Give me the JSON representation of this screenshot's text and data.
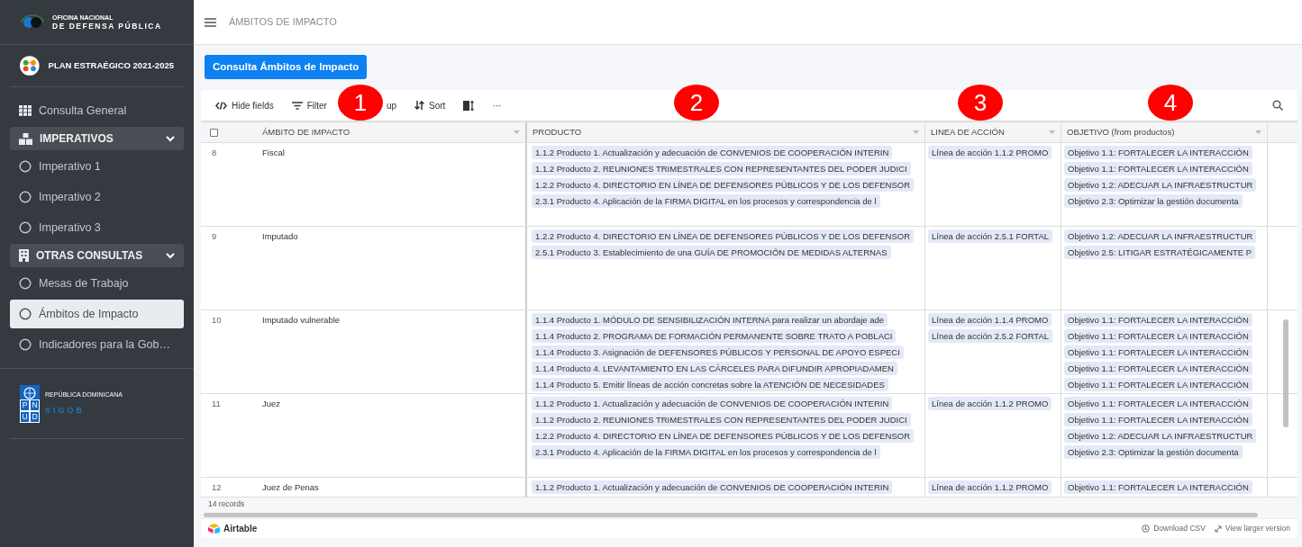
{
  "sidebar": {
    "org_logo": {
      "line1": "OFICINA NACIONAL",
      "line2": "DE DEFENSA PÚBLICA"
    },
    "plan_title": "PLAN ESTRAÉGICO 2021-2025",
    "nav": [
      {
        "kind": "link",
        "label": "Consulta General",
        "selected": false
      },
      {
        "kind": "group",
        "label": "IMPERATIVOS",
        "expanded": true,
        "selected": false
      },
      {
        "kind": "item",
        "label": "Imperativo 1",
        "selected": false
      },
      {
        "kind": "item",
        "label": "Imperativo 2",
        "selected": false
      },
      {
        "kind": "item",
        "label": "Imperativo 3",
        "selected": false
      },
      {
        "kind": "group",
        "label": "OTRAS CONSULTAS",
        "expanded": true,
        "selected": false
      },
      {
        "kind": "item",
        "label": "Mesas de Trabajo",
        "selected": false
      },
      {
        "kind": "item",
        "label": "Ámbitos de Impacto",
        "selected": true
      },
      {
        "kind": "item",
        "label": "Indicadores para la Gob…",
        "selected": false
      }
    ],
    "footer": {
      "pnud_letters": [
        "P",
        "N",
        "U",
        "D"
      ],
      "country": "REPÚBLICA DOMINICANA",
      "brand": "SIGOB"
    }
  },
  "header": {
    "title": "ÁMBITOS DE IMPACTO"
  },
  "action_button": "Consulta Ámbitos de Impacto",
  "toolbar": [
    {
      "kind": "hide",
      "label": "Hide fields"
    },
    {
      "kind": "filter",
      "label": "Filter"
    },
    {
      "kind": "group",
      "label": "up"
    },
    {
      "kind": "sort",
      "label": "Sort"
    },
    {
      "kind": "height"
    },
    {
      "kind": "more",
      "label": "···"
    }
  ],
  "annotations": [
    "1",
    "2",
    "3",
    "4"
  ],
  "table": {
    "select_all_checked": false,
    "columns": [
      "ÁMBITO DE IMPACTO",
      "PRODUCTO",
      "LINEA DE ACCIÓN",
      "OBJETIVO (from productos)"
    ],
    "rows": [
      {
        "number": "8",
        "ambito": "Fiscal",
        "productos": [
          "1.1.2 Producto 1. Actualización y adecuación de CONVENIOS DE COOPERACIÓN INTERIN",
          "1.1.2 Producto 2. REUNIONES TRIMESTRALES CON REPRESENTANTES DEL PODER JUDICI",
          "1.2.2 Producto 4. DIRECTORIO EN LÍNEA DE DEFENSORES PÚBLICOS Y DE LOS DEFENSOR",
          "2.3.1 Producto 4. Aplicación de la FIRMA DIGITAL en los procesos y correspondencia de l"
        ],
        "lineas": [
          "Línea de acción 1.1.2 PROMO"
        ],
        "objetivos": [
          "Objetivo 1.1: FORTALECER LA INTERACCIÓN",
          "Objetivo 1.1: FORTALECER LA INTERACCIÓN",
          "Objetivo 1.2: ADECUAR LA INFRAESTRUCTUR",
          "Objetivo 2.3: Optimizar la gestión documenta"
        ]
      },
      {
        "number": "9",
        "ambito": "Imputado",
        "productos": [
          "1.2.2 Producto 4. DIRECTORIO EN LÍNEA DE DEFENSORES PÚBLICOS Y DE LOS DEFENSOR",
          "2.5.1 Producto 3. Establecimiento de una GUÍA DE PROMOCIÓN DE MEDIDAS ALTERNAS"
        ],
        "lineas": [
          "Línea de acción 2.5.1 FORTAL"
        ],
        "objetivos": [
          "Objetivo 1.2: ADECUAR LA INFRAESTRUCTUR",
          "Objetivo 2.5: LITIGAR ESTRATÉGICAMENTE P"
        ]
      },
      {
        "number": "10",
        "ambito": "Imputado vulnerable",
        "productos": [
          "1.1.4 Producto 1. MÓDULO DE SENSIBILIZACIÓN INTERNA para realizar un abordaje ade",
          "1.1.4 Producto 2. PROGRAMA DE FORMACIÓN PERMANENTE SOBRE TRATO A POBLACI",
          "1.1.4 Producto 3. Asignación de DEFENSORES PÚBLICOS Y PERSONAL DE APOYO ESPECI",
          "1.1.4 Producto 4. LEVANTAMIENTO EN LAS CÁRCELES PARA DIFUNDIR APROPIADAMEN",
          "1.1.4 Producto 5. Emitir líneas de acción concretas sobre la ATENCIÓN DE NECESIDADES"
        ],
        "lineas": [
          "Línea de acción 1.1.4 PROMO",
          "Línea de acción 2.5.2 FORTAL"
        ],
        "objetivos": [
          "Objetivo 1.1: FORTALECER LA INTERACCIÓN",
          "Objetivo 1.1: FORTALECER LA INTERACCIÓN",
          "Objetivo 1.1: FORTALECER LA INTERACCIÓN",
          "Objetivo 1.1: FORTALECER LA INTERACCIÓN",
          "Objetivo 1.1: FORTALECER LA INTERACCIÓN"
        ]
      },
      {
        "number": "11",
        "ambito": "Juez",
        "productos": [
          "1.1.2 Producto 1. Actualización y adecuación de CONVENIOS DE COOPERACIÓN INTERIN",
          "1.1.2 Producto 2. REUNIONES TRIMESTRALES CON REPRESENTANTES DEL PODER JUDICI",
          "1.2.2 Producto 4. DIRECTORIO EN LÍNEA DE DEFENSORES PÚBLICOS Y DE LOS DEFENSOR",
          "2.3.1 Producto 4. Aplicación de la FIRMA DIGITAL en los procesos y correspondencia de l"
        ],
        "lineas": [
          "Línea de acción 1.1.2 PROMO"
        ],
        "objetivos": [
          "Objetivo 1.1: FORTALECER LA INTERACCIÓN",
          "Objetivo 1.1: FORTALECER LA INTERACCIÓN",
          "Objetivo 1.2: ADECUAR LA INFRAESTRUCTUR",
          "Objetivo 2.3: Optimizar la gestión documenta"
        ]
      },
      {
        "number": "12",
        "ambito": "Juez de Penas",
        "productos": [
          "1.1.2 Producto 1. Actualización y adecuación de CONVENIOS DE COOPERACIÓN INTERIN"
        ],
        "lineas": [
          "Línea de acción 1.1.2 PROMO"
        ],
        "objetivos": [
          "Objetivo 1.1: FORTALECER LA INTERACCIÓN"
        ]
      }
    ],
    "record_count": "14 records"
  },
  "footer": {
    "brand": "Airtable",
    "download": "Download CSV",
    "larger": "View larger version"
  }
}
